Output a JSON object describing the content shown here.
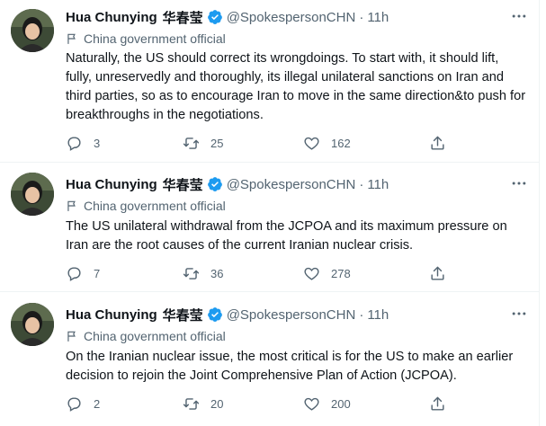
{
  "tweets": [
    {
      "author": {
        "name": "Hua Chunying",
        "name_cn": "华春莹",
        "handle": "@SpokespersonCHN",
        "verified": true
      },
      "time": "11h",
      "separator": "·",
      "label": "China government official",
      "text": "Naturally, the US should correct its wrongdoings. To start with, it should lift, fully, unreservedly and thoroughly, its illegal unilateral sanctions on Iran and third parties, so as to encourage Iran to move in the same direction&to push for breakthroughs in the negotiations.",
      "stats": {
        "replies": "3",
        "retweets": "25",
        "likes": "162"
      }
    },
    {
      "author": {
        "name": "Hua Chunying",
        "name_cn": "华春莹",
        "handle": "@SpokespersonCHN",
        "verified": true
      },
      "time": "11h",
      "separator": "·",
      "label": "China government official",
      "text": "The US unilateral withdrawal from the JCPOA and its maximum pressure on Iran are the root causes of the current Iranian nuclear crisis.",
      "stats": {
        "replies": "7",
        "retweets": "36",
        "likes": "278"
      }
    },
    {
      "author": {
        "name": "Hua Chunying",
        "name_cn": "华春莹",
        "handle": "@SpokespersonCHN",
        "verified": true
      },
      "time": "11h",
      "separator": "·",
      "label": "China government official",
      "text": "On the Iranian nuclear issue, the most critical is for the US to make an earlier decision to rejoin the Joint Comprehensive Plan of Action (JCPOA).",
      "stats": {
        "replies": "2",
        "retweets": "20",
        "likes": "200"
      }
    }
  ],
  "icons": {
    "verified": "verified-badge-icon",
    "more": "more-horizontal-icon",
    "label": "flag-icon",
    "reply": "reply-icon",
    "retweet": "retweet-icon",
    "like": "heart-icon",
    "share": "share-icon"
  },
  "colors": {
    "verified": "#1d9bf0",
    "text": "#0f1419",
    "secondary": "#536471",
    "divider": "#eff3f4"
  }
}
